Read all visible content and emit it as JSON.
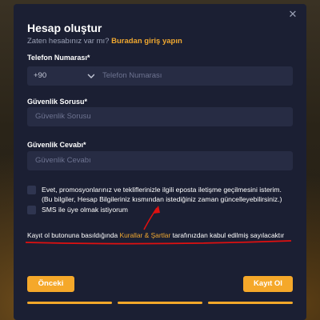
{
  "modal": {
    "title": "Hesap oluştur",
    "subtitle_prefix": "Zaten hesabınız var mı?",
    "login_link": "Buradan giriş yapın",
    "close_glyph": "✕"
  },
  "phone": {
    "label": "Telefon Numarası*",
    "country_code": "+90",
    "placeholder": "Telefon Numarası"
  },
  "security_question": {
    "label": "Güvenlik Sorusu*",
    "placeholder": "Güvenlik Sorusu"
  },
  "security_answer": {
    "label": "Güvenlik Cevabı*",
    "placeholder": "Güvenlik Cevabı"
  },
  "consents": [
    {
      "checked": false,
      "text": "Evet, promosyonlarınız ve tekliflerinizle ilgili eposta iletişme geçilmesini isterim. (Bu bilgiler, Hesap Bilgileriniz kısmından istediğiniz zaman güncelleyebilirsiniz.)"
    },
    {
      "checked": false,
      "text": "SMS ile üye olmak istiyorum"
    }
  ],
  "terms": {
    "prefix": "Kayıt ol butonuna basıldığında",
    "link": "Kurallar & Şartlar",
    "suffix": "tarafınızdan kabul edilmiş sayılacaktır"
  },
  "buttons": {
    "back": "Önceki",
    "submit": "Kayıt Ol"
  },
  "progress": {
    "steps_total": 3,
    "steps_completed": 3
  },
  "annotation": {
    "color": "#e01010"
  },
  "colors": {
    "accent": "#f5a82a",
    "modal_bg": "#1b1f33",
    "input_bg": "#272c44"
  }
}
